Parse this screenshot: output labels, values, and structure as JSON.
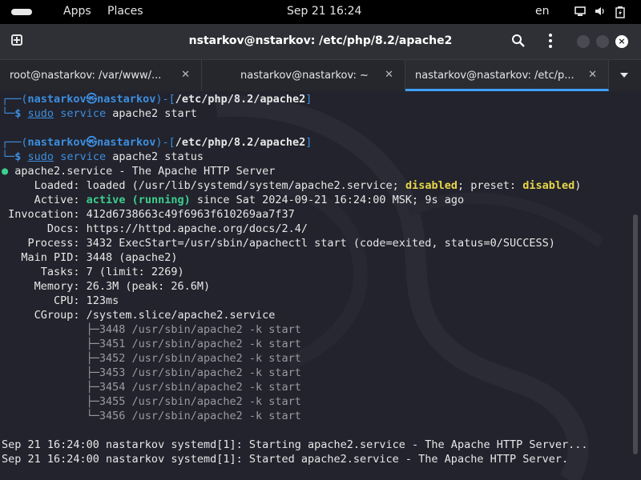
{
  "topbar": {
    "apps": "Apps",
    "places": "Places",
    "clock": "Sep 21  16:24",
    "lang": "en"
  },
  "window": {
    "title": "nstarkov@nstarkov: /etc/php/8.2/apache2"
  },
  "tabs": [
    {
      "label": "root@nastarkov: /var/www/...",
      "active": false
    },
    {
      "label": "nastarkov@nastarkov: ~",
      "active": false
    },
    {
      "label": "nastarkov@nastarkov: /etc/p...",
      "active": true
    }
  ],
  "terminal": {
    "p1": {
      "user": "nastarkov",
      "at": "㉿",
      "host": "nastarkov",
      "path": "/etc/php/8.2/apache2",
      "cmd_sudo": "sudo",
      "cmd_service": "service",
      "cmd_rest": " apache2 start"
    },
    "p2": {
      "user": "nastarkov",
      "at": "㉿",
      "host": "nastarkov",
      "path": "/etc/php/8.2/apache2",
      "cmd_sudo": "sudo",
      "cmd_service": "service",
      "cmd_rest": " apache2 status"
    },
    "unit": "apache2.service - The Apache HTTP Server",
    "loaded_label": "     Loaded:",
    "loaded_a": " loaded (/usr/lib/systemd/system/apache2.service; ",
    "loaded_dis1": "disabled",
    "loaded_b": "; preset: ",
    "loaded_dis2": "disabled",
    "loaded_c": ")",
    "active_label": "     Active:",
    "active_state": " active (running)",
    "active_rest": " since Sat 2024-09-21 16:24:00 MSK; 9s ago",
    "invocation": " Invocation: 412d6738663c49f6963f610269aa7f37",
    "docs": "       Docs: https://httpd.apache.org/docs/2.4/",
    "process": "    Process: 3432 ExecStart=/usr/sbin/apachectl start (code=exited, status=0/SUCCESS)",
    "mainpid": "   Main PID: 3448 (apache2)",
    "tasks": "      Tasks: 7 (limit: 2269)",
    "memory": "     Memory: 26.3M (peak: 26.6M)",
    "cpu": "        CPU: 123ms",
    "cgroup": "     CGroup: /system.slice/apache2.service",
    "procs": [
      "             ├─3448 /usr/sbin/apache2 -k start",
      "             ├─3451 /usr/sbin/apache2 -k start",
      "             ├─3452 /usr/sbin/apache2 -k start",
      "             ├─3453 /usr/sbin/apache2 -k start",
      "             ├─3454 /usr/sbin/apache2 -k start",
      "             ├─3455 /usr/sbin/apache2 -k start",
      "             └─3456 /usr/sbin/apache2 -k start"
    ],
    "log1": "Sep 21 16:24:00 nastarkov systemd[1]: Starting apache2.service - The Apache HTTP Server...",
    "log2": "Sep 21 16:24:00 nastarkov systemd[1]: Started apache2.service - The Apache HTTP Server."
  },
  "colors": {
    "accent": "#3d8fe0",
    "active_green": "#3ccf8e",
    "warn_yellow": "#e8d64a"
  }
}
